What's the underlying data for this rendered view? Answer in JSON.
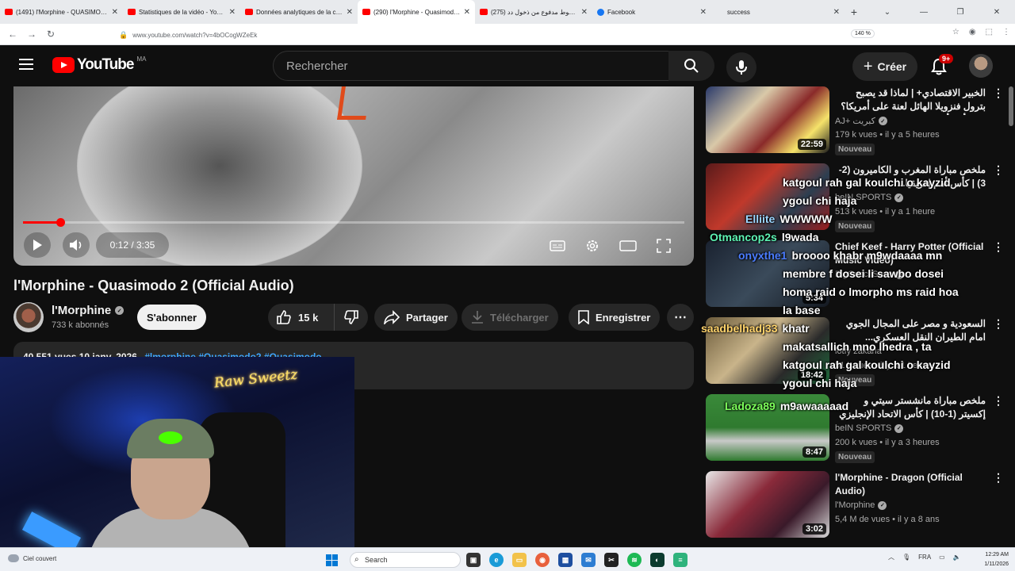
{
  "browser": {
    "tabs": [
      {
        "title": "(1491) l'Morphine - QUASIMODO",
        "fav": "youtube"
      },
      {
        "title": "Statistiques de la vidéo - YouTu",
        "fav": "youtube"
      },
      {
        "title": "Données analytiques de la chaî",
        "fav": "youtube"
      },
      {
        "title": "(290) l'Morphine - Quasimodo 2",
        "fav": "youtube",
        "active": true
      },
      {
        "title": "(275) خطوط مدفوع من ذخول دد",
        "fav": "youtube"
      },
      {
        "title": "Facebook",
        "fav": "facebook"
      },
      {
        "title": "success",
        "fav": "none"
      }
    ],
    "new_tab": "+",
    "url": "www.youtube.com/watch?v=4bOCogWZeEk",
    "zoom": "140 %"
  },
  "masthead": {
    "logo_text": "YouTube",
    "country_code": "MA",
    "search_placeholder": "Rechercher",
    "create_label": "Créer",
    "notifications_badge": "9+"
  },
  "player": {
    "time": "0:12 / 3:35",
    "progress_fraction": 0.056
  },
  "video": {
    "title": "l'Morphine - Quasimodo 2 (Official Audio)",
    "channel": "l'Morphine",
    "subscribers": "733 k abonnés",
    "subscribe_label": "S'abonner",
    "likes": "15 k",
    "share_label": "Partager",
    "download_label": "Télécharger",
    "save_label": "Enregistrer",
    "description_meta": "40 551 vues  10 janv. 2026",
    "description_tags": "#lmorphine #Quasimodo2 #Quasimodo"
  },
  "recommendations": [
    {
      "title": "الخبير الاقتصادي+ | لماذا قد يصبح بترول فنزويلا الهائل لعنة على أمريكا؟ كيف أخطأ...",
      "rtl": true,
      "channel": "AJ+ كبريت",
      "verified": true,
      "meta": "179 k vues • il y a 5 heures",
      "badge": "Nouveau",
      "duration": "22:59",
      "thumb": "news"
    },
    {
      "title": "ملخص مباراة المغرب و الكاميرون (2-3) | كأس أمم إفريقيا...",
      "rtl": true,
      "channel": "beIN SPORTS",
      "verified": true,
      "meta": "513 k vues • il y a 1 heure",
      "badge": "Nouveau",
      "duration": "",
      "thumb": "football-red"
    },
    {
      "title": "Chief Keef - Harry Potter (Official Music Video)",
      "rtl": false,
      "channel": "BigGucci Sosa",
      "verified": true,
      "meta": "",
      "badge": "",
      "duration": "5:34",
      "thumb": "dark-music"
    },
    {
      "title": "السعودية و مصر على المجال الجوي امام الطيران النقل العسكري...",
      "rtl": true,
      "channel": "lotfy zakaria",
      "verified": false,
      "meta": "51 k vues • il y a 1 heure",
      "badge": "Nouveau",
      "duration": "18:42",
      "thumb": "saudi"
    },
    {
      "title": "ملخص مباراة مانشستر سيتي و إكسيتر (1-10) | كأس الاتحاد الإنجليزي - الدور...",
      "rtl": true,
      "channel": "beIN SPORTS",
      "verified": true,
      "meta": "200 k vues • il y a 3 heures",
      "badge": "Nouveau",
      "duration": "8:47",
      "thumb": "football-green"
    },
    {
      "title": "l'Morphine - Dragon (Official Audio)",
      "rtl": false,
      "channel": "l'Morphine",
      "verified": true,
      "meta": "5,4 M de vues • il y a 8 ans",
      "badge": "",
      "duration": "3:02",
      "thumb": "dragon"
    }
  ],
  "chat": [
    {
      "user": "",
      "user_color": "#ffffff",
      "text": "katgoul rah gal koulchi o kayzid"
    },
    {
      "user": "",
      "user_color": "#ffffff",
      "text": "ygoul chi haja"
    },
    {
      "user": "Elliite",
      "user_color": "#9ad6ff",
      "text": "WWWWW"
    },
    {
      "user": "Otmancop2s",
      "user_color": "#5df3b3",
      "text": "l9wada"
    },
    {
      "user": "onyxthe1",
      "user_color": "#4a7cff",
      "text": "broooo khabr m9wdaaaa mn"
    },
    {
      "user": "",
      "user_color": "#ffffff",
      "text": "membre f dosei li sawbo dosei"
    },
    {
      "user": "",
      "user_color": "#ffffff",
      "text": "homa raid o lmorpho ms raid hoa"
    },
    {
      "user": "",
      "user_color": "#ffffff",
      "text": "la base"
    },
    {
      "user": "saadbelhadj33",
      "user_color": "#ffd36b",
      "text": "khatr"
    },
    {
      "user": "",
      "user_color": "#ffffff",
      "text": "makatsallich mno lhedra , ta"
    },
    {
      "user": "",
      "user_color": "#ffffff",
      "text": "katgoul rah gal koulchi o kayzid"
    },
    {
      "user": "",
      "user_color": "#ffffff",
      "text": "ygoul chi haja"
    },
    {
      "user": "Ladoza89",
      "user_color": "#7cff5a",
      "text": "m9awaaaaad"
    }
  ],
  "webcam": {
    "neon_sign": "Raw Sweetz"
  },
  "taskbar": {
    "weather": "Ciel couvert",
    "search_label": "Search",
    "language": "FRA",
    "time": "12:29 AM",
    "date": "1/11/2026"
  },
  "colors": {
    "youtube_red": "#ff0000",
    "link_blue": "#3ea6ff",
    "bg": "#0f0f0f"
  }
}
